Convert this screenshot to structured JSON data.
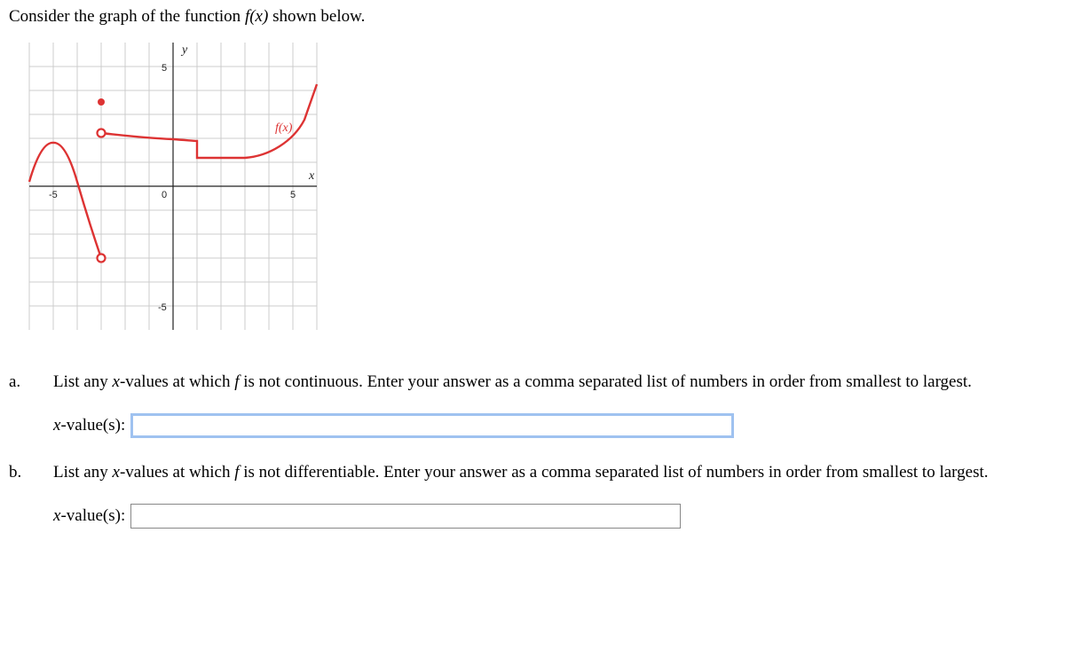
{
  "intro": {
    "prefix": "Consider the graph of the function ",
    "func": "f(x)",
    "suffix": " shown below."
  },
  "graph": {
    "axis_y_label": "y",
    "axis_x_label": "x",
    "curve_label": "f(x)",
    "ticks": {
      "neg5": "-5",
      "zero": "0",
      "pos5": "5",
      "y_pos5": "5",
      "y_neg5": "-5"
    }
  },
  "part_a": {
    "label": "a.",
    "text_before": "List any ",
    "var": "x",
    "text_mid": "-values at which ",
    "func": "f",
    "text_after": " is not continuous. Enter your answer as a comma separated list of numbers in order from smallest to largest.",
    "input_label_var": "x",
    "input_label_rest": "-value(s):",
    "value": ""
  },
  "part_b": {
    "label": "b.",
    "text_before": "List any ",
    "var": "x",
    "text_mid": "-values at which ",
    "func": "f",
    "text_after": " is not differentiable. Enter your answer as a comma separated list of numbers in order from smallest to largest.",
    "input_label_var": "x",
    "input_label_rest": "-value(s):",
    "value": ""
  },
  "chart_data": {
    "type": "line",
    "title": "",
    "xlabel": "x",
    "ylabel": "y",
    "xlim": [
      -6,
      6
    ],
    "ylim": [
      -6,
      6
    ],
    "series": [
      {
        "name": "f(x) left segment",
        "x": [
          -6,
          -5.5,
          -5,
          -4.5,
          -4,
          -3.5,
          -3
        ],
        "y": [
          0.2,
          1.0,
          1.8,
          1.0,
          0.2,
          -1.5,
          -3
        ]
      },
      {
        "name": "f(x) right segment",
        "x": [
          -3,
          -2,
          -1,
          0,
          1,
          1,
          2,
          3,
          4,
          5,
          5.5,
          6
        ],
        "y": [
          2.2,
          2.1,
          2.0,
          1.95,
          1.9,
          1.2,
          1.2,
          1.2,
          1.3,
          1.9,
          2.8,
          4.5
        ]
      }
    ],
    "points": [
      {
        "x": -3,
        "y": -3,
        "type": "open"
      },
      {
        "x": -3,
        "y": 2.2,
        "type": "open"
      },
      {
        "x": -3,
        "y": 3.5,
        "type": "closed"
      }
    ],
    "annotations": [
      {
        "text": "f(x)",
        "x": 4.7,
        "y": 2.4
      }
    ]
  }
}
